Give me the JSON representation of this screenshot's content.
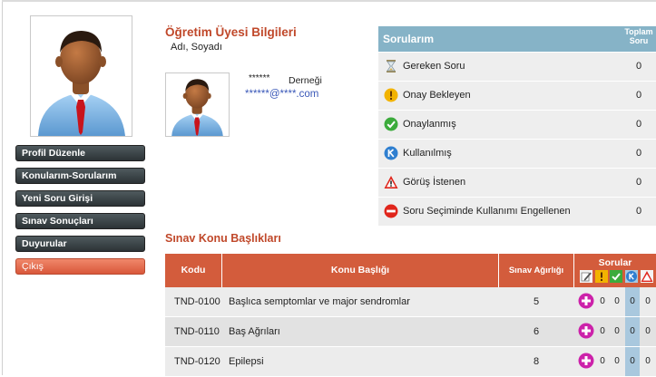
{
  "menu": {
    "items": [
      {
        "label": "Profil Düzenle"
      },
      {
        "label": "Konularım-Sorularım"
      },
      {
        "label": "Yeni Soru Girişi"
      },
      {
        "label": "Sınav Sonuçları"
      },
      {
        "label": "Duyurular"
      }
    ],
    "exit_label": "Çıkış"
  },
  "teacher": {
    "title": "Öğretim Üyesi Bilgileri",
    "name_label": "Adı, Soyadı",
    "masked_name": "******",
    "association": "Derneği",
    "email": "******@****.com"
  },
  "questions": {
    "title": "Sorularım",
    "total_header_line1": "Toplam",
    "total_header_line2": "Soru",
    "rows": [
      {
        "icon": "hourglass-icon",
        "label": "Gereken Soru",
        "count": "0"
      },
      {
        "icon": "exclamation-icon",
        "label": "Onay Bekleyen",
        "count": "0"
      },
      {
        "icon": "checkmark-icon",
        "label": "Onaylanmış",
        "count": "0"
      },
      {
        "icon": "k-badge-icon",
        "label": "Kullanılmış",
        "count": "0"
      },
      {
        "icon": "warning-icon",
        "label": "Görüş İstenen",
        "count": "0"
      },
      {
        "icon": "no-entry-icon",
        "label": "Soru Seçiminde Kullanımı Engellenen",
        "count": "0"
      }
    ]
  },
  "topics": {
    "section_title": "Sınav Konu Başlıkları",
    "headers": {
      "code": "Kodu",
      "topic": "Konu Başlığı",
      "weight": "Sınav Ağırlığı",
      "questions": "Sorular"
    },
    "rows": [
      {
        "code": "TND-0100",
        "topic": "Başlıca semptomlar ve major sendromlar",
        "weight": "5",
        "counts": [
          "0",
          "0",
          "0",
          "0"
        ]
      },
      {
        "code": "TND-0110",
        "topic": "Baş Ağrıları",
        "weight": "6",
        "counts": [
          "0",
          "0",
          "0",
          "0"
        ]
      },
      {
        "code": "TND-0120",
        "topic": "Epilepsi",
        "weight": "8",
        "counts": [
          "0",
          "0",
          "0",
          "0"
        ]
      }
    ]
  },
  "colors": {
    "accent": "#c0482a",
    "table_header": "#d35c3c",
    "panel_header": "#86b3c7",
    "add_button": "#cc22aa"
  }
}
